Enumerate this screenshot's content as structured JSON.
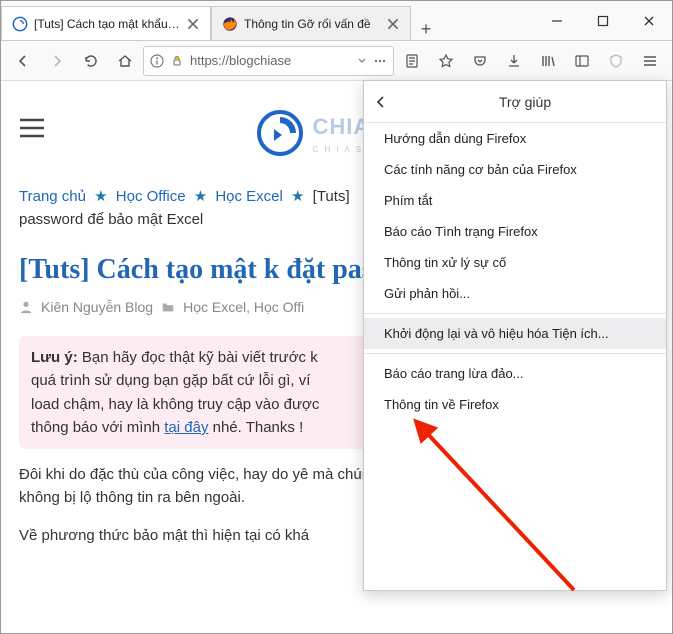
{
  "titlebar": {
    "tabs": [
      {
        "label": "[Tuts] Cách tạo mật khẩu chi",
        "active": true
      },
      {
        "label": "Thông tin Gỡ rối vấn đề",
        "active": false
      }
    ]
  },
  "toolbar": {
    "url": "https://blogchiase"
  },
  "page": {
    "logo_text": "CHIASEK",
    "logo_sub": "C H I A  S Ẻ",
    "breadcrumb": {
      "home": "Trang chủ",
      "hoc_office": "Học Office",
      "hoc_excel": "Học Excel",
      "tuts": "[Tuts]",
      "tail": "password để bảo mật Excel"
    },
    "post_title": "[Tuts] Cách tạo mật k đặt password để bảo n",
    "meta": {
      "author": "Kiên Nguyễn Blog",
      "cat": "Học Excel, Học Offi"
    },
    "notice": {
      "label": "Lưu ý:",
      "text1": "Bạn hãy đọc thật kỹ bài viết trước k",
      "text2": "quá trình sử dụng bạn gặp bất cứ lỗi gì, ví ",
      "text3": "load chậm, hay là không truy cập vào được",
      "text4_a": "thông báo với mình ",
      "link": "tại đây",
      "text4_b": " nhé. Thanks !"
    },
    "para1": "Đôi khi do đặc thù của công việc, hay do yê mà chúng ta cần phải thực hiện bảo mật ch để không bị lộ thông tin ra bên ngoài.",
    "para2": "Về phương thức bảo mật thì hiện tại có khá"
  },
  "panel": {
    "title": "Trợ giúp",
    "items": [
      "Hướng dẫn dùng Firefox",
      "Các tính năng cơ bản của Firefox",
      "Phím tắt",
      "Báo cáo Tình trạng Firefox",
      "Thông tin xử lý sự cố",
      "Gửi phản hồi...",
      "Khởi động lại và vô hiệu hóa Tiện ích...",
      "Báo cáo trang lừa đảo...",
      "Thông tin về Firefox"
    ]
  }
}
